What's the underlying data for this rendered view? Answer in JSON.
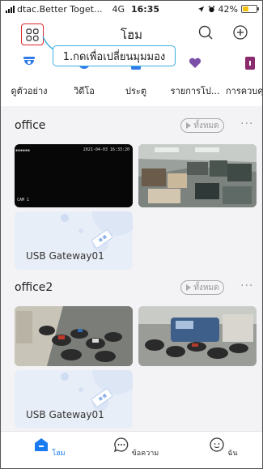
{
  "status_bar": {
    "carrier": "dtac.Better Toget...",
    "network": "4G",
    "time": "16:35",
    "battery": "42%",
    "battery_level": 0.42
  },
  "header": {
    "title": "โฮม",
    "icons": [
      "grid-view-icon",
      "search-icon",
      "add-icon"
    ]
  },
  "callout": {
    "text": "1.กดเพื่อเปลี่ยนมุมมอง",
    "border_color": "#3aaee2"
  },
  "categories": [
    {
      "label": "ดูตัวอย่าง",
      "icon": "camera-icon"
    },
    {
      "label": "วิดีโอ",
      "icon": "video-icon"
    },
    {
      "label": "ประตู",
      "icon": "door-icon"
    },
    {
      "label": "รายการโป...",
      "icon": "favorite-icon"
    },
    {
      "label": "การควบคุ",
      "icon": "control-icon"
    }
  ],
  "sections": [
    {
      "title": "office",
      "all_label": "ทั้งหมด",
      "camera_overlay": {
        "timestamp": "2021-04-03 16:33:20",
        "name": "CAM 1"
      },
      "gateway_label": "USB Gateway01"
    },
    {
      "title": "office2",
      "all_label": "ทั้งหมด",
      "gateway_label": "USB Gateway01"
    }
  ],
  "bottom_nav": [
    {
      "label": "โฮม",
      "icon": "home-icon",
      "active": true
    },
    {
      "label": "ข้อความ",
      "icon": "message-icon",
      "active": false
    },
    {
      "label": "ฉัน",
      "icon": "profile-icon",
      "active": false
    }
  ],
  "colors": {
    "accent": "#1a7bf0",
    "category_icon": "#2f7ce8",
    "highlight": "#d9262c",
    "favorite": "#7b4fa8",
    "control": "#8a2b6e"
  }
}
